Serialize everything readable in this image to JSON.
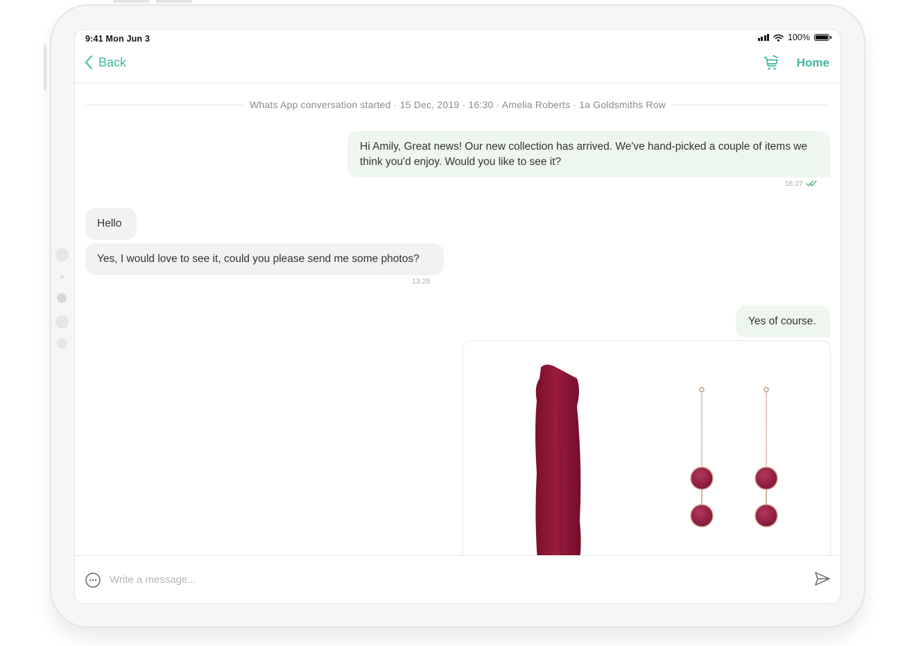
{
  "status_bar": {
    "time": "9:41 Mon Jun 3",
    "battery": "100%"
  },
  "nav": {
    "back_label": "Back",
    "home_label": "Home",
    "cart_icon": "cart-icon"
  },
  "system_message": "Whats App conversation started · 15 Dec, 2019 · 16:30 · Amelia Roberts · 1a Goldsmiths Row",
  "messages": [
    {
      "direction": "outgoing",
      "text": "Hi Amily, Great news! Our new collection has arrived. We've hand-picked a couple of items we think you'd enjoy. Would you like to see it?",
      "time": "16:27",
      "status_icon": "double-check-icon"
    },
    {
      "direction": "incoming",
      "text": "Hello"
    },
    {
      "direction": "incoming",
      "text": "Yes, I would love to see it, could you please send me some photos?",
      "time": "13:28"
    },
    {
      "direction": "outgoing",
      "text": "Yes of course."
    }
  ],
  "product_card": {
    "items": [
      "dress-image",
      "earrings-image"
    ]
  },
  "composer": {
    "placeholder": "Write a message..."
  },
  "colors": {
    "accent": "#3fb59e",
    "outgoing_bubble": "#eef7ee",
    "incoming_bubble": "#f2f2f2",
    "product": "#8e1535"
  }
}
